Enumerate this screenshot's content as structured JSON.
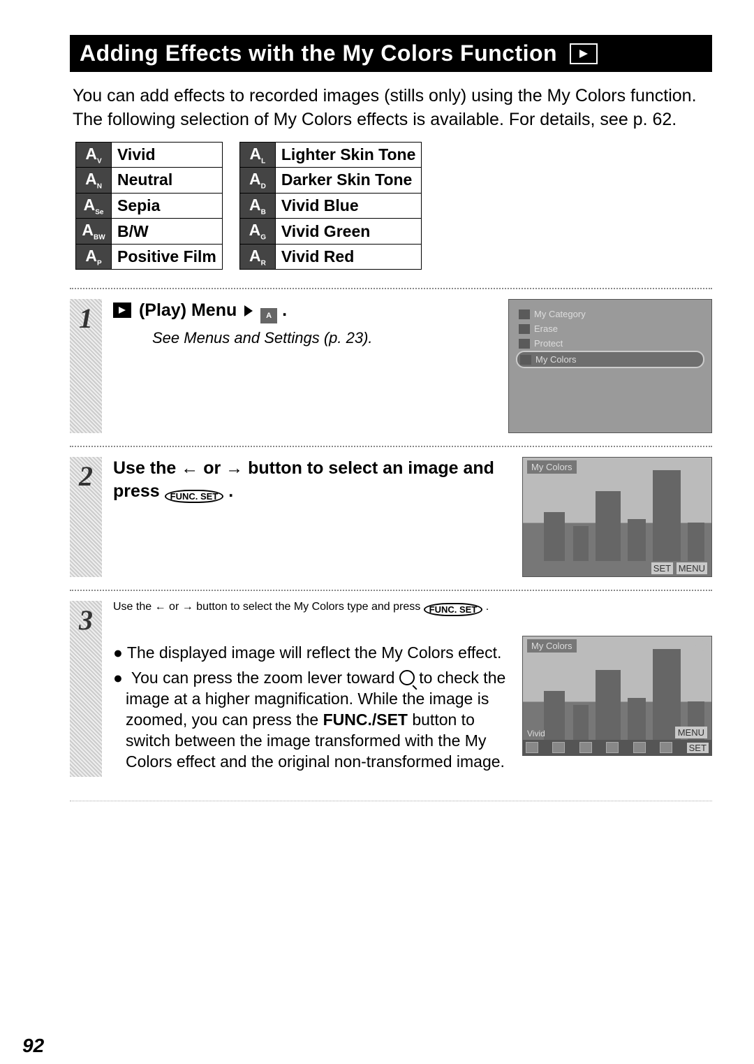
{
  "title": "Adding Effects with the My Colors Function",
  "intro": "You can add effects to recorded images (stills only) using the My Colors function. The following selection of My Colors effects is available. For details, see p. 62.",
  "effects_left": [
    {
      "code": "V",
      "label": "Vivid"
    },
    {
      "code": "N",
      "label": "Neutral"
    },
    {
      "code": "Se",
      "label": "Sepia"
    },
    {
      "code": "BW",
      "label": "B/W"
    },
    {
      "code": "P",
      "label": "Positive Film"
    }
  ],
  "effects_right": [
    {
      "code": "L",
      "label": "Lighter Skin Tone"
    },
    {
      "code": "D",
      "label": "Darker Skin Tone"
    },
    {
      "code": "B",
      "label": "Vivid Blue"
    },
    {
      "code": "G",
      "label": "Vivid Green"
    },
    {
      "code": "R",
      "label": "Vivid Red"
    }
  ],
  "step1": {
    "num": "1",
    "head_prefix": "(Play) Menu",
    "subref": "See Menus and Settings (p. 23).",
    "menu_items": [
      "My Category",
      "Erase",
      "Protect"
    ],
    "menu_selected": "My Colors"
  },
  "step2": {
    "num": "2",
    "head_a": "Use the ",
    "head_b": " or ",
    "head_c": " button to select an image and press ",
    "func": "FUNC.\nSET",
    "shot_tag": "My Colors",
    "shot_set": "SET",
    "shot_menu": "MENU"
  },
  "step3": {
    "num": "3",
    "head_a": "Use the ",
    "head_b": " or ",
    "head_c": " button to select the My Colors type and press ",
    "func": "FUNC.\nSET",
    "bullet1": "The displayed image will reflect the My Colors effect.",
    "bullet2_a": "You can press the zoom lever toward ",
    "bullet2_b": " to check the image at a higher magnification. While the image is zoomed, you can press the ",
    "bullet2_c": "FUNC./SET",
    "bullet2_d": " button to switch between the image transformed with the My Colors effect and the original non-transformed image.",
    "shot_tag": "My Colors",
    "shot_label": "Vivid",
    "shot_menu": "MENU",
    "shot_set": "SET"
  },
  "page_number": "92"
}
